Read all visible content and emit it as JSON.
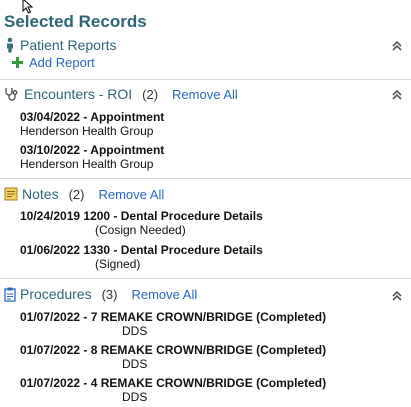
{
  "panel": {
    "title": "Selected Records"
  },
  "patient_reports": {
    "label": "Patient Reports",
    "add_report_label": "Add Report"
  },
  "encounters": {
    "label": "Encounters - ROI",
    "count": "(2)",
    "remove_all": "Remove All",
    "items": [
      {
        "date": "03/04/2022",
        "type": "Appointment",
        "org": "Henderson Health Group"
      },
      {
        "date": "03/10/2022",
        "type": "Appointment",
        "org": "Henderson Health Group"
      }
    ]
  },
  "notes": {
    "label": "Notes",
    "count": "(2)",
    "remove_all": "Remove All",
    "items": [
      {
        "date_time": "10/24/2019 1200",
        "title": "Dental Procedure Details",
        "status": "(Cosign Needed)"
      },
      {
        "date_time": "01/06/2022 1330",
        "title": "Dental Procedure Details",
        "status": "(Signed)"
      }
    ]
  },
  "procedures": {
    "label": "Procedures",
    "count": "(3)",
    "remove_all": "Remove All",
    "items": [
      {
        "date": "01/07/2022",
        "desc": "7 REMAKE CROWN/BRIDGE (Completed)",
        "provider": "DDS"
      },
      {
        "date": "01/07/2022",
        "desc": "8 REMAKE CROWN/BRIDGE (Completed)",
        "provider": "DDS"
      },
      {
        "date": "01/07/2022",
        "desc": "4 REMAKE CROWN/BRIDGE (Completed)",
        "provider": "DDS"
      }
    ]
  },
  "separator": " - ",
  "colors": {
    "heading": "#2d6676",
    "link": "#2a66c4",
    "add_icon": "#3a9a3a",
    "notes_icon": "#d8a21a",
    "procedures_icon": "#2a66c4"
  }
}
